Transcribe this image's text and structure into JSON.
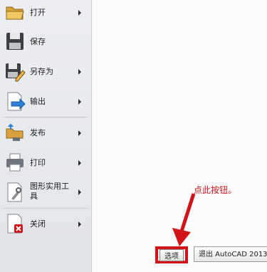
{
  "menu": {
    "items": [
      {
        "label": "打开",
        "icon": "folder-open-icon",
        "has_submenu": true
      },
      {
        "label": "保存",
        "icon": "floppy-disk-icon",
        "has_submenu": false
      },
      {
        "label": "另存为",
        "icon": "save-as-icon",
        "has_submenu": true
      },
      {
        "label": "输出",
        "icon": "export-icon",
        "has_submenu": true
      },
      {
        "label": "发布",
        "icon": "publish-icon",
        "has_submenu": true
      },
      {
        "label": "打印",
        "icon": "printer-icon",
        "has_submenu": true
      },
      {
        "label": "图形实用工具",
        "icon": "drawing-utilities-icon",
        "has_submenu": true
      },
      {
        "label": "关闭",
        "icon": "close-document-icon",
        "has_submenu": true
      }
    ]
  },
  "buttons": {
    "options_label": "选项",
    "exit_label": "退出 AutoCAD 2013"
  },
  "annotation": {
    "text": "点此按钮。"
  },
  "colors": {
    "highlight": "#d2141a",
    "panel_bg": "#e6e8eb"
  }
}
